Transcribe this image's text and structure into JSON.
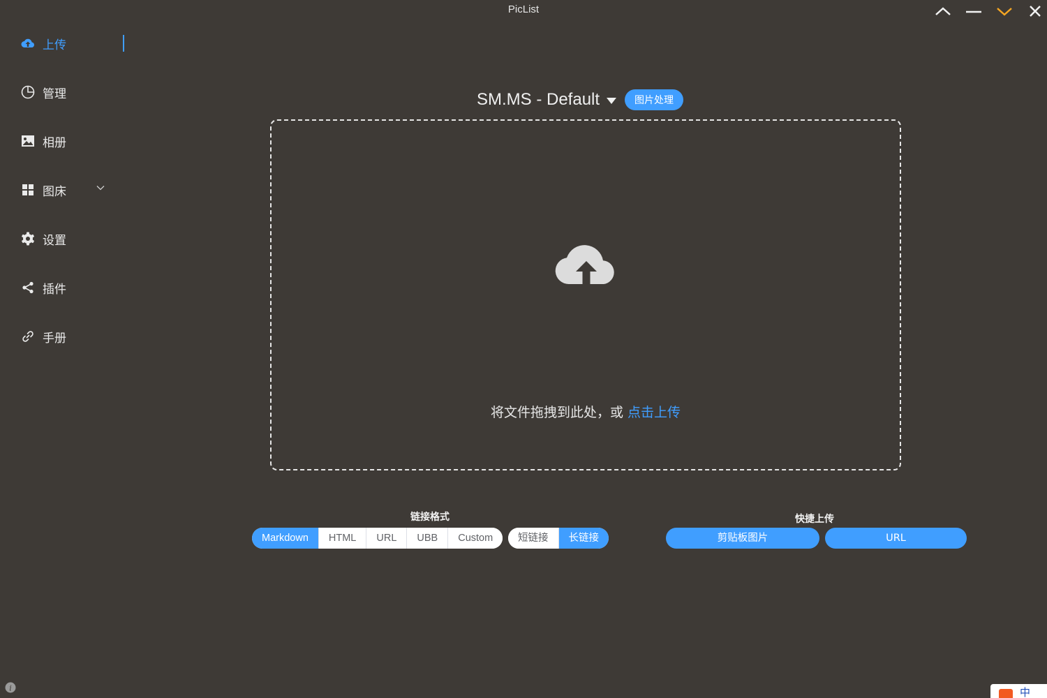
{
  "app": {
    "title": "PicList"
  },
  "window": {
    "accent_color": "#f5a623"
  },
  "sidebar": {
    "items": [
      {
        "label": "上传",
        "icon": "upload-cloud-icon",
        "active": true
      },
      {
        "label": "管理",
        "icon": "pie-chart-icon"
      },
      {
        "label": "相册",
        "icon": "image-icon"
      },
      {
        "label": "图床",
        "icon": "grid-icon",
        "expandable": true
      },
      {
        "label": "设置",
        "icon": "gear-icon"
      },
      {
        "label": "插件",
        "icon": "share-icon"
      },
      {
        "label": "手册",
        "icon": "link-icon"
      }
    ]
  },
  "upload": {
    "picbed_name": "SM.MS - Default",
    "image_process_label": "图片处理",
    "drop_text": "将文件拖拽到此处，或 ",
    "drop_link": "点击上传"
  },
  "link_format": {
    "label": "链接格式",
    "options": [
      "Markdown",
      "HTML",
      "URL",
      "UBB",
      "Custom"
    ],
    "selected": "Markdown",
    "length_options": [
      "短链接",
      "长链接"
    ],
    "length_selected": "长链接"
  },
  "quick_upload": {
    "label": "快捷上传",
    "clipboard_label": "剪贴板图片",
    "url_label": "URL"
  },
  "ime": {
    "char": "中"
  },
  "colors": {
    "primary": "#409eff",
    "background": "#3e3a36"
  }
}
